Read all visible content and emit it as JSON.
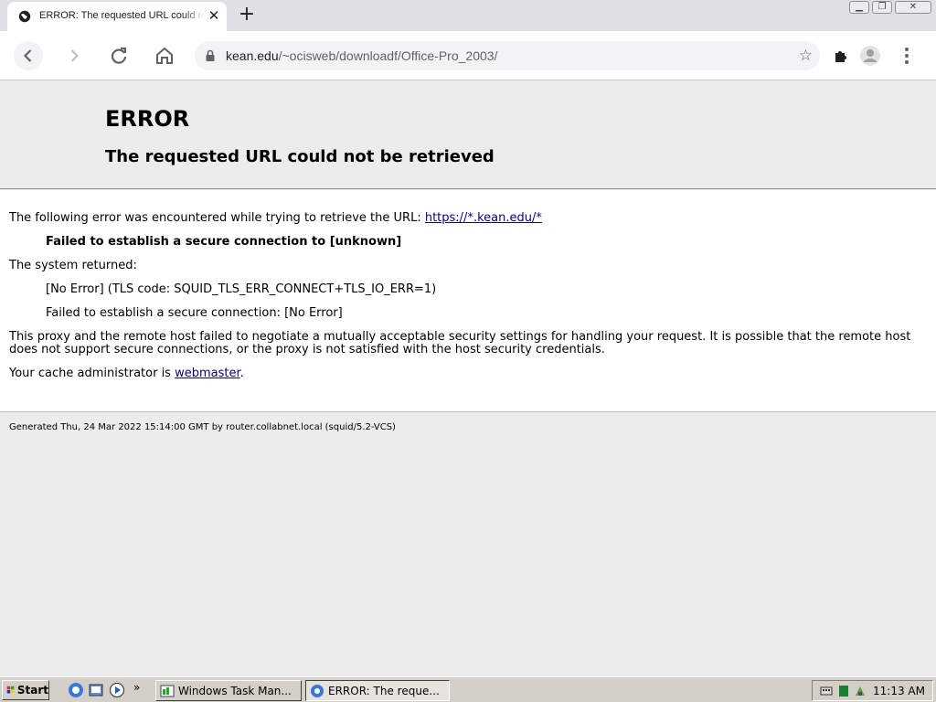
{
  "browser": {
    "tab_title": "ERROR: The requested URL could not be retrieved",
    "new_tab_icon": "plus-icon",
    "url_host": "kean.edu",
    "url_path": "/~ocisweb/downloadf/Office-Pro_2003/"
  },
  "page": {
    "title": "ERROR",
    "subtitle": "The requested URL could not be retrieved",
    "intro_text": "The following error was encountered while trying to retrieve the URL: ",
    "intro_link": "https://*.kean.edu/*",
    "error_reason": "Failed to establish a secure connection to [unknown]",
    "system_returned": "The system returned:",
    "returned_code": "[No Error] (TLS code: SQUID_TLS_ERR_CONNECT+TLS_IO_ERR=1)",
    "returned_detail": "Failed to establish a secure connection: [No Error]",
    "explanation": "This proxy and the remote host failed to negotiate a mutually acceptable security settings for handling your request. It is possible that the remote host does not support secure connections, or the proxy is not satisfied with the host security credentials.",
    "admin_prefix": "Your cache administrator is ",
    "admin_link": "webmaster",
    "admin_suffix": ".",
    "footer": "Generated Thu, 24 Mar 2022 15:14:00 GMT by router.collabnet.local (squid/5.2-VCS)"
  },
  "taskbar": {
    "start_label": "Start",
    "more_label": "»",
    "task1_label": "Windows Task Man...",
    "task2_label": "ERROR: The reque...",
    "clock": "11:13 AM"
  }
}
